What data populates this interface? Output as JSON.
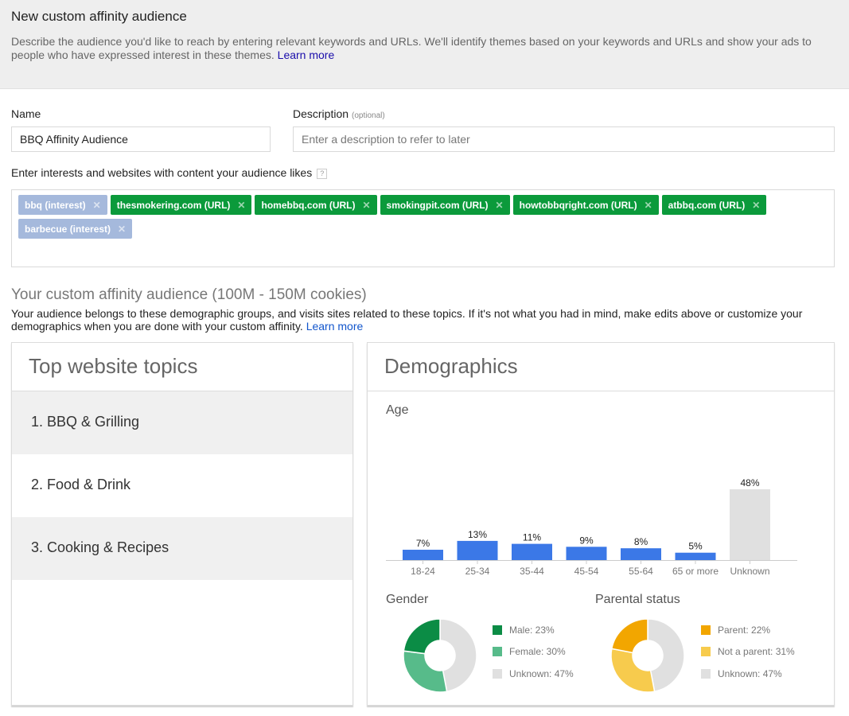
{
  "header": {
    "title": "New custom affinity audience",
    "description": "Describe the audience you'd like to reach by entering relevant keywords and URLs. We'll identify themes based on your keywords and URLs and show your ads to people who have expressed interest in these themes.",
    "learn_more": "Learn more"
  },
  "form": {
    "name_label": "Name",
    "name_value": "BBQ Affinity Audience",
    "description_label": "Description",
    "description_optional": "(optional)",
    "description_placeholder": "Enter a description to refer to later",
    "interests_label": "Enter interests and websites with content your audience likes",
    "help_icon": "?",
    "tags": [
      {
        "label": "bbq (interest)",
        "type": "interest"
      },
      {
        "label": "thesmokering.com (URL)",
        "type": "url"
      },
      {
        "label": "homebbq.com (URL)",
        "type": "url"
      },
      {
        "label": "smokingpit.com (URL)",
        "type": "url"
      },
      {
        "label": "howtobbqright.com (URL)",
        "type": "url"
      },
      {
        "label": "atbbq.com (URL)",
        "type": "url"
      },
      {
        "label": "barbecue (interest)",
        "type": "interest"
      }
    ],
    "remove_icon": "✕"
  },
  "audience": {
    "title": "Your custom affinity audience (100M - 150M cookies)",
    "description": "Your audience belongs to these demographic groups, and visits sites related to these topics. If it's not what you had in mind, make edits above or customize your demographics when you are done with your custom affinity.",
    "learn_more": "Learn more"
  },
  "topics": {
    "title": "Top website topics",
    "items": [
      "1. BBQ & Grilling",
      "2. Food & Drink",
      "3. Cooking & Recipes"
    ]
  },
  "demographics": {
    "title": "Demographics",
    "age_label": "Age",
    "gender_label": "Gender",
    "parental_label": "Parental status"
  },
  "colors": {
    "age_bar": "#3b78e7",
    "unknown": "#e0e0e0",
    "male": "#0b8c45",
    "female": "#57bb8a",
    "parent": "#f2a600",
    "not_parent": "#f7cb4d"
  },
  "chart_data": [
    {
      "type": "bar",
      "title": "Age",
      "categories": [
        "18-24",
        "25-34",
        "35-44",
        "45-54",
        "55-64",
        "65 or more",
        "Unknown"
      ],
      "values": [
        7,
        13,
        11,
        9,
        8,
        5,
        48
      ],
      "data_labels": [
        "7%",
        "13%",
        "11%",
        "9%",
        "8%",
        "5%",
        "48%"
      ],
      "ylim": [
        0,
        48
      ],
      "xlabel": "",
      "ylabel": "",
      "grid": false
    },
    {
      "type": "pie",
      "title": "Gender",
      "labels": [
        "Male",
        "Female",
        "Unknown"
      ],
      "values": [
        23,
        30,
        47
      ],
      "legend": [
        "Male: 23%",
        "Female: 30%",
        "Unknown: 47%"
      ],
      "legend_position": "right"
    },
    {
      "type": "pie",
      "title": "Parental status",
      "labels": [
        "Parent",
        "Not a parent",
        "Unknown"
      ],
      "values": [
        22,
        31,
        47
      ],
      "legend": [
        "Parent: 22%",
        "Not a parent: 31%",
        "Unknown: 47%"
      ],
      "legend_position": "right"
    }
  ]
}
